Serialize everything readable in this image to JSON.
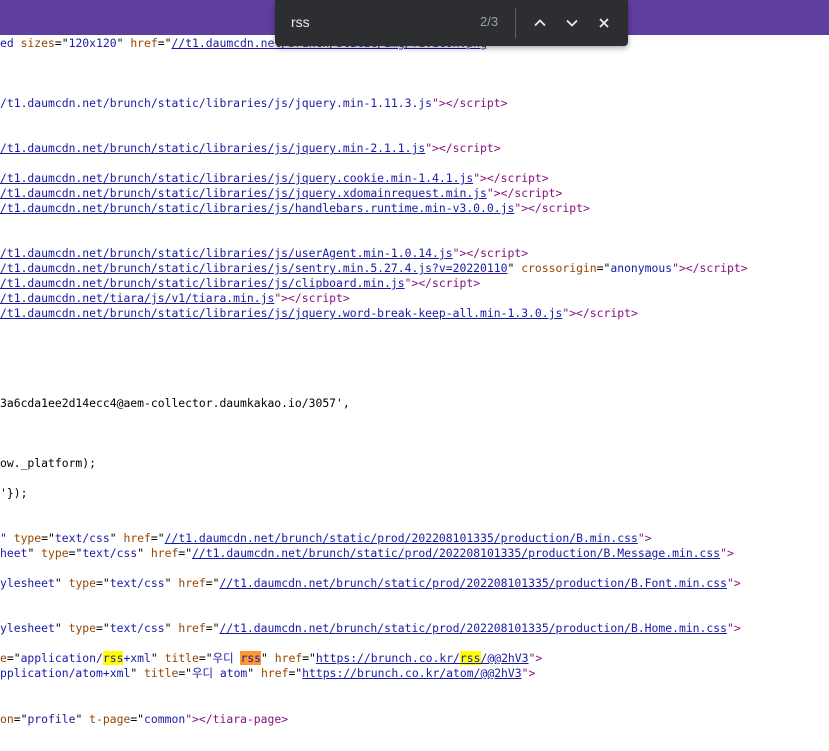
{
  "find": {
    "query": "rss",
    "count": "2/3",
    "prev_icon": "chevron-up-icon",
    "next_icon": "chevron-down-icon",
    "close_icon": "close-icon"
  },
  "lines": {
    "l1": {
      "a": "ed",
      "b": " sizes",
      "c": "=\"",
      "d": "120x120",
      "e": "\" ",
      "f": "href",
      "g": "=\"",
      "h": "//t1.daumcdn.net/brunch/static/img/favicon.png",
      "i": "\""
    },
    "l2": {
      "a": "/t1.daumcdn.net/brunch/static/libraries/js/jquery.min-1.11.3.js",
      "b": "\"></",
      "c": "script",
      "d": ">"
    },
    "l3": {
      "a": "/t1.daumcdn.net/brunch/static/libraries/js/jquery.min-2.1.1.js",
      "b": "\"></",
      "c": "script",
      "d": ">"
    },
    "l4": {
      "a": "/t1.daumcdn.net/brunch/static/libraries/js/jquery.cookie.min-1.4.1.js",
      "b": "\"></",
      "c": "script",
      "d": ">"
    },
    "l5": {
      "a": "/t1.daumcdn.net/brunch/static/libraries/js/jquery.xdomainrequest.min.js",
      "b": "\"></",
      "c": "script",
      "d": ">"
    },
    "l6": {
      "a": "/t1.daumcdn.net/brunch/static/libraries/js/handlebars.runtime.min-v3.0.0.js",
      "b": "\"></",
      "c": "script",
      "d": ">"
    },
    "l7": {
      "a": "/t1.daumcdn.net/brunch/static/libraries/js/userAgent.min-1.0.14.js",
      "b": "\"></",
      "c": "script",
      "d": ">"
    },
    "l8": {
      "a": "/t1.daumcdn.net/brunch/static/libraries/js/sentry.min.5.27.4.js?v=20220110",
      "b": "\" ",
      "c": "crossorigin",
      "d": "=\"",
      "e": "anonymous",
      "f": "\"></",
      "g": "script",
      "h": ">"
    },
    "l9": {
      "a": "/t1.daumcdn.net/brunch/static/libraries/js/clipboard.min.js",
      "b": "\"></",
      "c": "script",
      "d": ">"
    },
    "l10": {
      "a": "/t1.daumcdn.net/tiara/js/v1/tiara.min.js",
      "b": "\"></",
      "c": "script",
      "d": ">"
    },
    "l11": {
      "a": "/t1.daumcdn.net/brunch/static/libraries/js/jquery.word-break-keep-all.min-1.3.0.js",
      "b": "\"></",
      "c": "script",
      "d": ">"
    },
    "l12": {
      "a": "3a6cda1ee2d14ecc4@aem-collector.daumkakao.io/3057',"
    },
    "l13": {
      "a": "ow._platform);"
    },
    "l14": {
      "a": "'});"
    },
    "l15": {
      "a": "\" ",
      "b": "type",
      "c": "=\"",
      "d": "text/css",
      "e": "\" ",
      "f": "href",
      "g": "=\"",
      "h": "//t1.daumcdn.net/brunch/static/prod/202208101335/production/B.min.css",
      "i": "\">"
    },
    "l16": {
      "a": "heet",
      "b": "\" ",
      "c": "type",
      "d": "=\"",
      "e": "text/css",
      "f": "\" ",
      "g": "href",
      "h": "=\"",
      "i": "//t1.daumcdn.net/brunch/static/prod/202208101335/production/B.Message.min.css",
      "j": "\">"
    },
    "l17": {
      "a": "ylesheet",
      "b": "\" ",
      "c": "type",
      "d": "=\"",
      "e": "text/css",
      "f": "\" ",
      "g": "href",
      "h": "=\"",
      "i": "//t1.daumcdn.net/brunch/static/prod/202208101335/production/B.Font.min.css",
      "j": "\">"
    },
    "l18": {
      "a": "ylesheet",
      "b": "\" ",
      "c": "type",
      "d": "=\"",
      "e": "text/css",
      "f": "\" ",
      "g": "href",
      "h": "=\"",
      "i": "//t1.daumcdn.net/brunch/static/prod/202208101335/production/B.Home.min.css",
      "j": "\">"
    },
    "l19": {
      "a": "e",
      "b": "=\"",
      "c": "application/",
      "d": "rss",
      "e": "+xml",
      "f": "\" ",
      "g": "title",
      "h": "=\"",
      "i": "우디 ",
      "j": "rss",
      "k": "\" ",
      "l": "href",
      "m": "=\"",
      "n": "https://brunch.co.kr/",
      "o": "rss",
      "p": "/@@2hV3",
      "q": "\">"
    },
    "l20": {
      "a": "pplication/atom+xml",
      "b": "\" ",
      "c": "title",
      "d": "=\"",
      "e": "우디 atom",
      "f": "\" ",
      "g": "href",
      "h": "=\"",
      "i": "https://brunch.co.kr/atom/@@2hV3",
      "j": "\">"
    },
    "l21": {
      "a": "on",
      "b": "=\"",
      "c": "profile",
      "d": "\" ",
      "e": "t-page",
      "f": "=\"",
      "g": "common",
      "h": "\"></",
      "i": "tiara-page",
      "j": ">"
    }
  },
  "colors": {
    "attr": "#994500",
    "value": "#1a1aa6",
    "tag": "#881280",
    "highlight": "#ffff00",
    "current_highlight": "#ff9632",
    "header_bar": "#5f3f9d",
    "find_bar": "#2d2e31"
  }
}
